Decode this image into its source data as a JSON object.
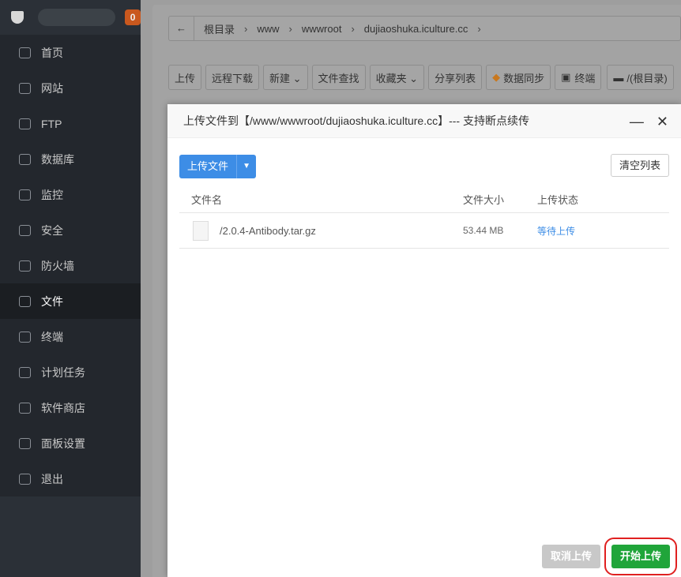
{
  "sidebar": {
    "badge": "0",
    "items": [
      {
        "label": "首页"
      },
      {
        "label": "网站"
      },
      {
        "label": "FTP"
      },
      {
        "label": "数据库"
      },
      {
        "label": "监控"
      },
      {
        "label": "安全"
      },
      {
        "label": "防火墙"
      },
      {
        "label": "文件"
      },
      {
        "label": "终端"
      },
      {
        "label": "计划任务"
      },
      {
        "label": "软件商店"
      },
      {
        "label": "面板设置"
      },
      {
        "label": "退出"
      }
    ]
  },
  "breadcrumb": {
    "back": "←",
    "segments": [
      "根目录",
      "www",
      "wwwroot",
      "dujiaoshuka.iculture.cc"
    ],
    "sep": "›"
  },
  "toolbar": [
    "上传",
    "远程下载",
    "新建 ⌄",
    "文件查找",
    "收藏夹 ⌄",
    "分享列表",
    "数据同步",
    "终端",
    "/(根目录)"
  ],
  "modal": {
    "title": "上传文件到【/www/wwwroot/dujiaoshuka.iculture.cc】--- 支持断点续传",
    "minimize": "—",
    "close": "✕",
    "upload_button": "上传文件",
    "clear_button": "清空列表",
    "columns": [
      "文件名",
      "文件大小",
      "上传状态"
    ],
    "files": [
      {
        "name": "/2.0.4-Antibody.tar.gz",
        "size": "53.44 MB",
        "status": "等待上传"
      }
    ],
    "cancel_button": "取消上传",
    "start_button": "开始上传"
  }
}
